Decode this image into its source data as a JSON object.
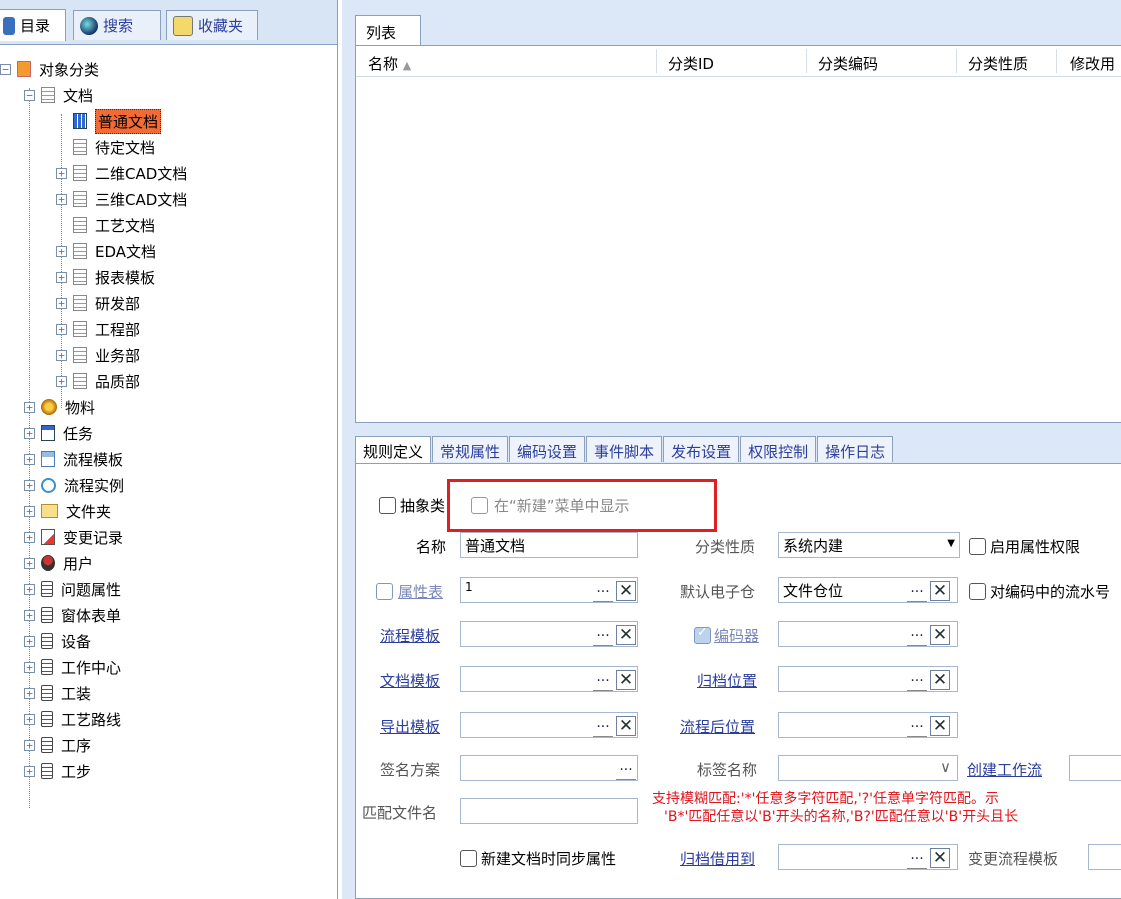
{
  "left_tabs": [
    {
      "label": "目录",
      "icon": "catalog-icon"
    },
    {
      "label": "搜索",
      "icon": "search-icon"
    },
    {
      "label": "收藏夹",
      "icon": "favorites-icon"
    }
  ],
  "tree": {
    "root": "对象分类",
    "documents": {
      "label": "文档",
      "children": [
        "普通文档",
        "待定文档",
        "二维CAD文档",
        "三维CAD文档",
        "工艺文档",
        "EDA文档",
        "报表模板",
        "研发部",
        "工程部",
        "业务部",
        "品质部"
      ]
    },
    "others": [
      "物料",
      "任务",
      "流程模板",
      "流程实例",
      "文件夹",
      "变更记录",
      "用户",
      "问题属性",
      "窗体表单",
      "设备",
      "工作中心",
      "工装",
      "工艺路线",
      "工序",
      "工步"
    ]
  },
  "list": {
    "tab": "列表",
    "columns": [
      "名称",
      "分类ID",
      "分类编码",
      "分类性质",
      "修改用"
    ]
  },
  "detail_tabs": [
    "规则定义",
    "常规属性",
    "编码设置",
    "事件脚本",
    "发布设置",
    "权限控制",
    "操作日志"
  ],
  "form": {
    "abstract_label": "抽象类",
    "show_in_new_label": "在“新建”菜单中显示",
    "name_label": "名称",
    "name_value": "普通文档",
    "category_nature_label": "分类性质",
    "category_nature_value": "系统内建",
    "enable_attr_perm_label": "启用属性权限",
    "attr_table_label": "属性表",
    "attr_table_value": "1",
    "default_vault_label": "默认电子仓",
    "default_vault_value": "文件仓位",
    "serial_label": "对编码中的流水号",
    "flow_template_label": "流程模板",
    "encoder_label": "编码器",
    "doc_template_label": "文档模板",
    "archive_location_label": "归档位置",
    "export_template_label": "导出模板",
    "post_flow_location_label": "流程后位置",
    "signature_label": "签名方案",
    "tag_name_label": "标签名称",
    "create_workflow_label": "创建工作流",
    "match_filename_label": "匹配文件名",
    "match_hint_1": "支持模糊匹配:'*'任意多字符匹配,'?'任意单字符匹配。示",
    "match_hint_2": "'B*'匹配任意以'B'开头的名称,'B?'匹配任意以'B'开头且长",
    "sync_attr_label": "新建文档时同步属性",
    "archive_borrow_label": "归档借用到",
    "change_flow_template_label": "变更流程模板",
    "ellipsis": "...",
    "clear": "✕",
    "dropdown_arrow": "▼",
    "chevron": "∨"
  }
}
